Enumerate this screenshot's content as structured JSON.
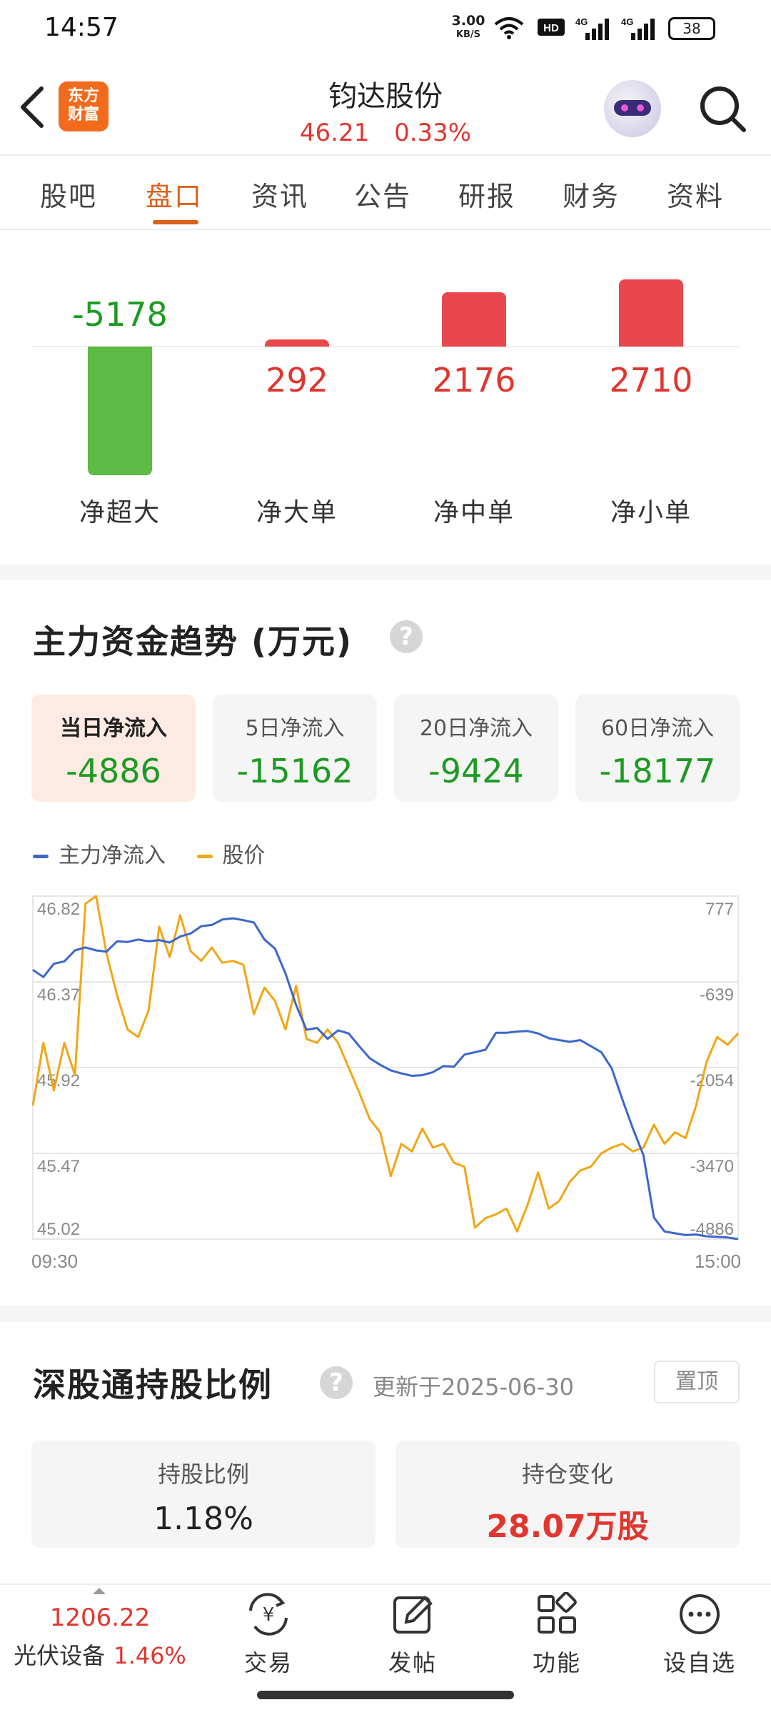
{
  "status_bar": {
    "time": "14:57",
    "net_speed": "3.00",
    "net_unit": "KB/S",
    "battery": "38",
    "icons": [
      "wifi-icon",
      "hd-icon",
      "signal-4g-icon",
      "signal-4g-icon",
      "battery-icon"
    ]
  },
  "header": {
    "logo_line1": "东方",
    "logo_line2": "财富",
    "stock_name": "钧达股份",
    "price": "46.21",
    "change_pct": "0.33%",
    "colors": {
      "up": "#e0362f",
      "down": "#1d9a22",
      "accent": "#d9621c"
    }
  },
  "tabs": [
    {
      "label": "股吧",
      "active": false
    },
    {
      "label": "盘口",
      "active": true
    },
    {
      "label": "资讯",
      "active": false
    },
    {
      "label": "公告",
      "active": false
    },
    {
      "label": "研报",
      "active": false
    },
    {
      "label": "财务",
      "active": false
    },
    {
      "label": "资料",
      "active": false
    }
  ],
  "order_flow": {
    "items": [
      {
        "label": "净超大",
        "value": "-5178",
        "num": -5178
      },
      {
        "label": "净大单",
        "value": "292",
        "num": 292
      },
      {
        "label": "净中单",
        "value": "2176",
        "num": 2176
      },
      {
        "label": "净小单",
        "value": "2710",
        "num": 2710
      }
    ]
  },
  "trend": {
    "title": "主力资金趋势 (万元)",
    "help": "?",
    "cards": [
      {
        "label": "当日净流入",
        "value": "-4886",
        "active": true
      },
      {
        "label": "5日净流入",
        "value": "-15162",
        "active": false
      },
      {
        "label": "20日净流入",
        "value": "-9424",
        "active": false
      },
      {
        "label": "60日净流入",
        "value": "-18177",
        "active": false
      }
    ],
    "legend_flow": "主力净流入",
    "legend_price": "股价"
  },
  "chart_data": {
    "type": "line",
    "x_start": "09:30",
    "x_end": "15:00",
    "left_axis_ticks": [
      "46.82",
      "46.37",
      "45.92",
      "45.47",
      "45.02"
    ],
    "right_axis_ticks": [
      "777",
      "-639",
      "-2054",
      "-3470",
      "-4886"
    ],
    "ylim_left": [
      45.02,
      46.82
    ],
    "ylim_right": [
      -4886,
      777
    ],
    "series": [
      {
        "name": "主力净流入",
        "axis": "right",
        "color": "#3b66cc",
        "values": [
          -440,
          -560,
          -340,
          -300,
          -120,
          -70,
          -120,
          -140,
          30,
          20,
          60,
          30,
          50,
          10,
          110,
          160,
          280,
          300,
          390,
          410,
          380,
          340,
          60,
          -90,
          -500,
          -1020,
          -1430,
          -1400,
          -1580,
          -1440,
          -1490,
          -1700,
          -1900,
          -2010,
          -2100,
          -2150,
          -2190,
          -2180,
          -2130,
          -2030,
          -2040,
          -1840,
          -1800,
          -1760,
          -1480,
          -1480,
          -1460,
          -1450,
          -1490,
          -1570,
          -1600,
          -1630,
          -1600,
          -1700,
          -1800,
          -2070,
          -2580,
          -3060,
          -3500,
          -4530,
          -4760,
          -4790,
          -4820,
          -4810,
          -4840,
          -4850,
          -4860,
          -4886
        ]
      },
      {
        "name": "股价",
        "axis": "left",
        "color": "#f2a614",
        "values": [
          45.72,
          46.05,
          45.8,
          46.05,
          45.88,
          46.78,
          46.85,
          46.52,
          46.3,
          46.12,
          46.08,
          46.22,
          46.66,
          46.5,
          46.72,
          46.53,
          46.48,
          46.55,
          46.47,
          46.48,
          46.46,
          46.2,
          46.34,
          46.27,
          46.12,
          46.35,
          46.07,
          46.05,
          46.12,
          46.05,
          45.92,
          45.79,
          45.65,
          45.58,
          45.35,
          45.52,
          45.48,
          45.6,
          45.5,
          45.52,
          45.42,
          45.4,
          45.08,
          45.13,
          45.15,
          45.18,
          45.06,
          45.2,
          45.37,
          45.18,
          45.22,
          45.32,
          45.38,
          45.4,
          45.47,
          45.5,
          45.52,
          45.48,
          45.5,
          45.62,
          45.52,
          45.58,
          45.55,
          45.72,
          45.95,
          46.08,
          46.04,
          46.1
        ]
      }
    ]
  },
  "sgt": {
    "title": "深股通持股比例",
    "help": "?",
    "update_text": "更新于2025-06-30",
    "pin_label": "置顶",
    "hold_ratio_label": "持股比例",
    "hold_ratio_value": "1.18%",
    "hold_change_label": "持仓变化",
    "hold_change_value": "28.07万股"
  },
  "bottom_bar": {
    "index_value": "1206.22",
    "index_name": "光伏设备",
    "index_change": "1.46%",
    "items": [
      {
        "label": "交易",
        "icon": "yen-exchange-icon"
      },
      {
        "label": "发帖",
        "icon": "edit-post-icon"
      },
      {
        "label": "功能",
        "icon": "grid-function-icon"
      },
      {
        "label": "设自选",
        "icon": "more-dots-icon"
      }
    ]
  }
}
